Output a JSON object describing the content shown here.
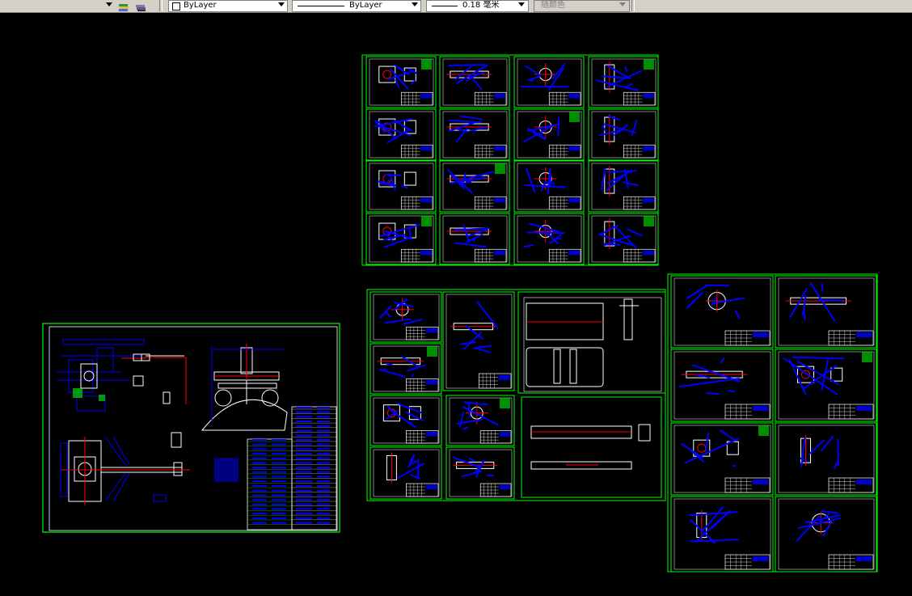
{
  "toolbar": {
    "layer_linetype_icon": "layer-stack-icon",
    "color_value": "ByLayer",
    "linetype_value": "ByLayer",
    "lineweight_value": "0.18 毫米",
    "plotstyle_value": "随颜色"
  },
  "colors": {
    "background": "#000000",
    "sheet_border": "#00ff00",
    "geometry_blue": "#0000ff",
    "geometry_white": "#ffffff",
    "geometry_red": "#ff0000"
  }
}
